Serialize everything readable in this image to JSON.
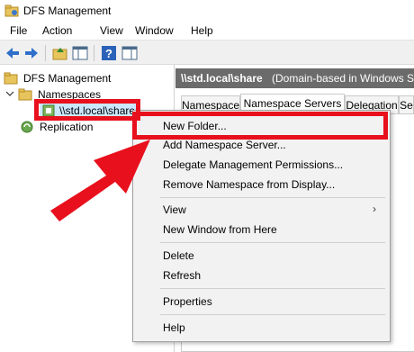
{
  "window": {
    "title": "DFS Management"
  },
  "menubar": {
    "items": [
      "File",
      "Action",
      "View",
      "Window",
      "Help"
    ]
  },
  "toolbar": {
    "buttons": [
      "back-icon",
      "forward-icon",
      "up-folder-icon",
      "show-hide-tree-icon",
      "help-icon",
      "properties-icon"
    ]
  },
  "tree": {
    "root_label": "DFS Management",
    "namespaces_label": "Namespaces",
    "namespace_label": "\\\\std.local\\share",
    "replication_label": "Replication"
  },
  "details": {
    "header_path": "\\\\std.local\\share",
    "header_type": "(Domain-based in Windows Se",
    "tabs": [
      "Namespace",
      "Namespace Servers",
      "Delegation",
      "Se"
    ]
  },
  "context_menu": {
    "new_folder": "New Folder...",
    "add_namespace_server": "Add Namespace Server...",
    "delegate_permissions": "Delegate Management Permissions...",
    "remove_namespace": "Remove Namespace from Display...",
    "view": "View",
    "view_arrow": "›",
    "new_window": "New Window from Here",
    "delete": "Delete",
    "refresh": "Refresh",
    "properties": "Properties",
    "help": "Help"
  },
  "colors": {
    "highlight": "#e8101d",
    "header_bg": "#6b6b6b",
    "toolbar_bg": "#f0f0f0",
    "menu_bg": "#f2f2f2"
  }
}
